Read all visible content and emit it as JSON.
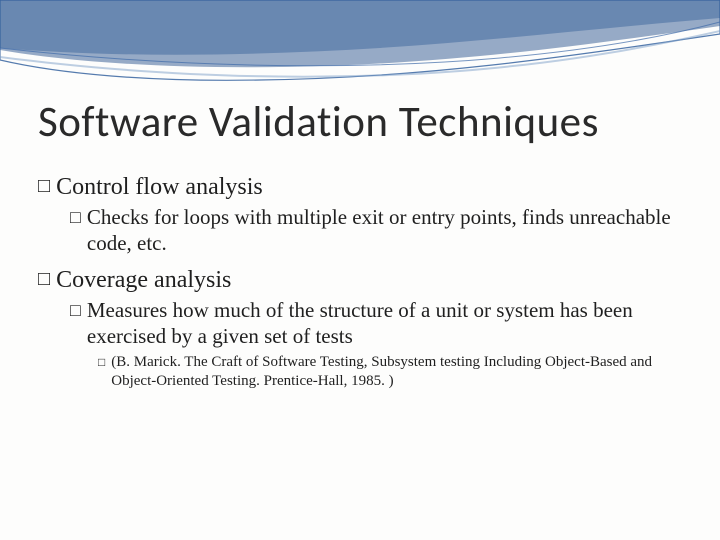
{
  "slide": {
    "title": "Software Validation Techniques",
    "items": [
      {
        "level": 1,
        "text": "Control flow analysis"
      },
      {
        "level": 2,
        "text": "Checks for loops with  multiple exit or entry points, finds unreachable  code, etc."
      },
      {
        "level": 1,
        "text": "Coverage analysis"
      },
      {
        "level": 2,
        "text": "Measures how much of the structure of a unit or system has been exercised by a given set of tests"
      },
      {
        "level": 3,
        "text": "(B. Marick. The Craft of Software Testing, Subsystem testing Including Object-Based and Object-Oriented Testing. Prentice-Hall, 1985. )"
      }
    ]
  },
  "bullet_glyph": "□"
}
